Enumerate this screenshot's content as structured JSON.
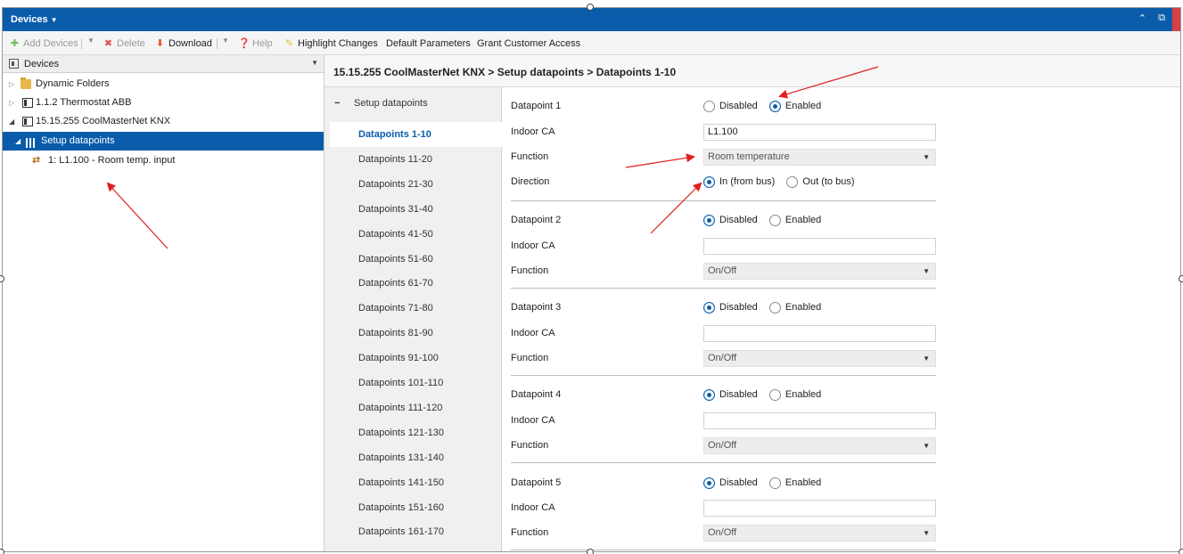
{
  "window": {
    "title": "Devices",
    "controls": [
      "chevron-up-icon",
      "restore-icon"
    ]
  },
  "toolbar": {
    "add_devices": "Add Devices",
    "delete": "Delete",
    "download": "Download",
    "help": "Help",
    "highlight_changes": "Highlight Changes",
    "default_parameters": "Default Parameters",
    "grant_customer_access": "Grant Customer Access"
  },
  "tree": {
    "header": "Devices",
    "items": [
      {
        "label": "Dynamic Folders",
        "icon": "folder-icon"
      },
      {
        "label": "1.1.2 Thermostat ABB",
        "icon": "device-icon"
      },
      {
        "label": "15.15.255 CoolMasterNet KNX",
        "icon": "device-icon"
      },
      {
        "label": "Setup datapoints",
        "icon": "setup-icon",
        "selected": true
      },
      {
        "label": "1: L1.100 - Room temp. input",
        "icon": "datapoint-icon"
      }
    ]
  },
  "breadcrumb": "15.15.255 CoolMasterNet KNX > Setup datapoints > Datapoints 1-10",
  "nav": {
    "header": "Setup datapoints",
    "items": [
      "Datapoints 1-10",
      "Datapoints 11-20",
      "Datapoints 21-30",
      "Datapoints 31-40",
      "Datapoints 41-50",
      "Datapoints 51-60",
      "Datapoints 61-70",
      "Datapoints 71-80",
      "Datapoints 81-90",
      "Datapoints 91-100",
      "Datapoints 101-110",
      "Datapoints 111-120",
      "Datapoints 121-130",
      "Datapoints 131-140",
      "Datapoints 141-150",
      "Datapoints 151-160",
      "Datapoints 161-170"
    ],
    "active": "Datapoints 1-10"
  },
  "labels": {
    "indoor_ca": "Indoor CA",
    "function": "Function",
    "direction": "Direction",
    "disabled": "Disabled",
    "enabled": "Enabled",
    "in_from_bus": "In (from bus)",
    "out_to_bus": "Out (to bus)"
  },
  "datapoints": [
    {
      "name": "Datapoint 1",
      "state": "Enabled",
      "indoor_ca": "L1.100",
      "function": "Room temperature",
      "direction": "In (from bus)"
    },
    {
      "name": "Datapoint 2",
      "state": "Disabled",
      "indoor_ca": "",
      "function": "On/Off"
    },
    {
      "name": "Datapoint 3",
      "state": "Disabled",
      "indoor_ca": "",
      "function": "On/Off"
    },
    {
      "name": "Datapoint 4",
      "state": "Disabled",
      "indoor_ca": "",
      "function": "On/Off"
    },
    {
      "name": "Datapoint 5",
      "state": "Disabled",
      "indoor_ca": "",
      "function": "On/Off"
    }
  ],
  "colors": {
    "accent": "#0a5cab",
    "annotation": "#e02020"
  }
}
